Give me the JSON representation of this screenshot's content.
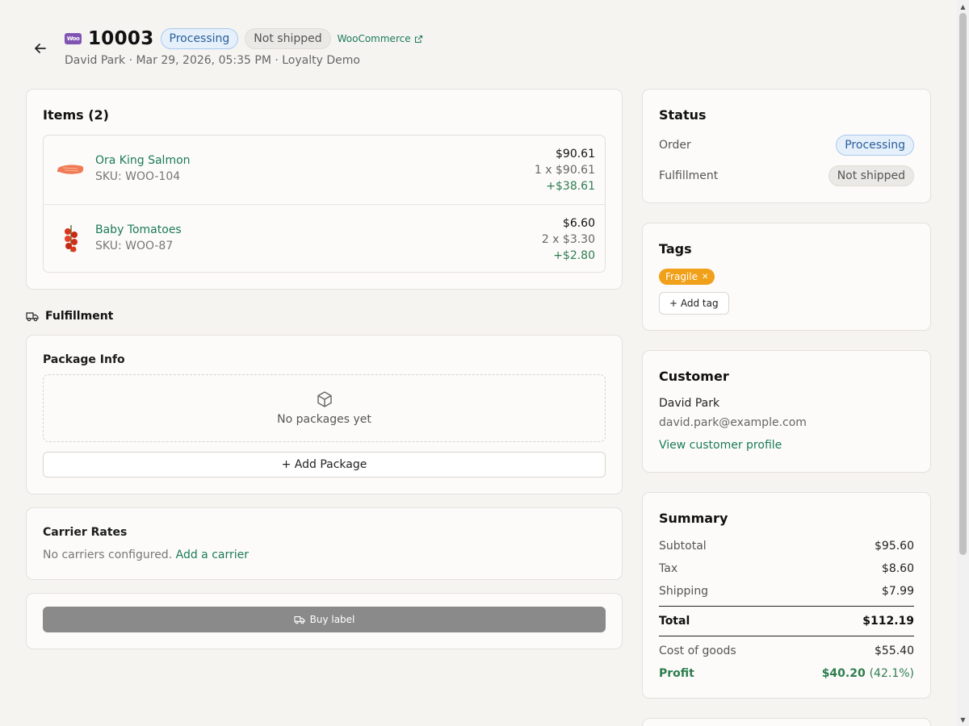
{
  "header": {
    "order_number": "10003",
    "status_badge": "Processing",
    "shipping_badge": "Not shipped",
    "source_link": "WooCommerce",
    "subline": "David Park · Mar 29, 2026, 05:35 PM · Loyalty Demo"
  },
  "items": {
    "title": "Items (2)",
    "list": [
      {
        "name": "Ora King Salmon",
        "sku": "SKU: WOO-104",
        "total": "$90.61",
        "qty": "1 x $90.61",
        "margin": "+$38.61"
      },
      {
        "name": "Baby Tomatoes",
        "sku": "SKU: WOO-87",
        "total": "$6.60",
        "qty": "2 x $3.30",
        "margin": "+$2.80"
      }
    ]
  },
  "fulfillment": {
    "heading": "Fulfillment",
    "package_title": "Package Info",
    "empty_text": "No packages yet",
    "add_package": "+ Add Package",
    "carrier_title": "Carrier Rates",
    "carrier_text": "No carriers configured.",
    "carrier_link": "Add a carrier",
    "buy_label": "Buy label"
  },
  "status": {
    "title": "Status",
    "order_label": "Order",
    "order_value": "Processing",
    "fulfillment_label": "Fulfillment",
    "fulfillment_value": "Not shipped"
  },
  "tags": {
    "title": "Tags",
    "items": [
      "Fragile"
    ],
    "add_label": "+ Add tag"
  },
  "customer": {
    "title": "Customer",
    "name": "David Park",
    "email": "david.park@example.com",
    "profile_link": "View customer profile"
  },
  "summary": {
    "title": "Summary",
    "subtotal_label": "Subtotal",
    "subtotal": "$95.60",
    "tax_label": "Tax",
    "tax": "$8.60",
    "shipping_label": "Shipping",
    "shipping": "$7.99",
    "total_label": "Total",
    "total": "$112.19",
    "cogs_label": "Cost of goods",
    "cogs": "$55.40",
    "profit_label": "Profit",
    "profit": "$40.20",
    "profit_pct": "(42.1%)"
  },
  "colors": {
    "accent_green": "#1b7a5a",
    "profit_green": "#2e7d4f",
    "tag_orange": "#f0a019",
    "woo_purple": "#7f54b3"
  },
  "icons": {
    "back": "arrow-left-icon",
    "woo": "woocommerce-logo",
    "external": "external-link-icon",
    "truck": "truck-icon",
    "package": "package-icon"
  }
}
